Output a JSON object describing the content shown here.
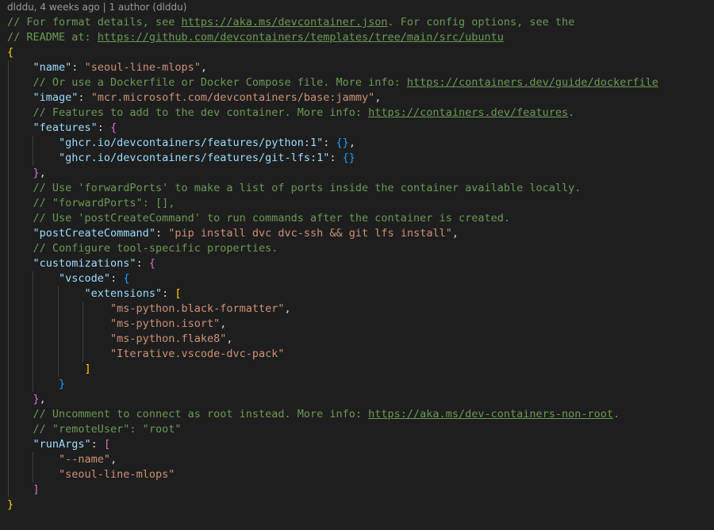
{
  "codelens": "dlddu, 4 weeks ago | 1 author (dlddu)",
  "colors": {
    "background": "#1e1e1e",
    "comment": "#6a9955",
    "key": "#9cdcfe",
    "string": "#ce9178",
    "bracket_level1": "#ffd700",
    "bracket_level2": "#da70d6",
    "bracket_level3": "#179fff"
  },
  "lines": [
    {
      "indent": 0,
      "tokens": [
        {
          "t": "// For format details, see ",
          "c": "cm"
        },
        {
          "t": "https://aka.ms/devcontainer.json",
          "c": "lnk"
        },
        {
          "t": ". For config options, see the",
          "c": "cm"
        }
      ]
    },
    {
      "indent": 0,
      "tokens": [
        {
          "t": "// README at: ",
          "c": "cm"
        },
        {
          "t": "https://github.com/devcontainers/templates/tree/main/src/ubuntu",
          "c": "lnk"
        }
      ]
    },
    {
      "indent": 0,
      "tokens": [
        {
          "t": "{",
          "c": "b1"
        }
      ]
    },
    {
      "indent": 1,
      "tokens": [
        {
          "t": "\"name\"",
          "c": "key"
        },
        {
          "t": ": ",
          "c": "pun"
        },
        {
          "t": "\"seoul-line-mlops\"",
          "c": "str"
        },
        {
          "t": ",",
          "c": "pun"
        }
      ]
    },
    {
      "indent": 1,
      "tokens": [
        {
          "t": "// Or use a Dockerfile or Docker Compose file. More info: ",
          "c": "cm"
        },
        {
          "t": "https://containers.dev/guide/dockerfile",
          "c": "lnk"
        }
      ]
    },
    {
      "indent": 1,
      "tokens": [
        {
          "t": "\"image\"",
          "c": "key"
        },
        {
          "t": ": ",
          "c": "pun"
        },
        {
          "t": "\"mcr.microsoft.com/devcontainers/base:jammy\"",
          "c": "str"
        },
        {
          "t": ",",
          "c": "pun"
        }
      ]
    },
    {
      "indent": 1,
      "tokens": [
        {
          "t": "// Features to add to the dev container. More info: ",
          "c": "cm"
        },
        {
          "t": "https://containers.dev/features",
          "c": "lnk"
        },
        {
          "t": ".",
          "c": "cm"
        }
      ]
    },
    {
      "indent": 1,
      "tokens": [
        {
          "t": "\"features\"",
          "c": "key"
        },
        {
          "t": ": ",
          "c": "pun"
        },
        {
          "t": "{",
          "c": "b2"
        }
      ]
    },
    {
      "indent": 2,
      "tokens": [
        {
          "t": "\"ghcr.io/devcontainers/features/python:1\"",
          "c": "key"
        },
        {
          "t": ": ",
          "c": "pun"
        },
        {
          "t": "{}",
          "c": "b3"
        },
        {
          "t": ",",
          "c": "pun"
        }
      ]
    },
    {
      "indent": 2,
      "tokens": [
        {
          "t": "\"ghcr.io/devcontainers/features/git-lfs:1\"",
          "c": "key"
        },
        {
          "t": ": ",
          "c": "pun"
        },
        {
          "t": "{}",
          "c": "b3"
        }
      ]
    },
    {
      "indent": 1,
      "tokens": [
        {
          "t": "}",
          "c": "b2"
        },
        {
          "t": ",",
          "c": "pun"
        }
      ]
    },
    {
      "indent": 1,
      "tokens": [
        {
          "t": "// Use 'forwardPorts' to make a list of ports inside the container available locally.",
          "c": "cm"
        }
      ]
    },
    {
      "indent": 1,
      "tokens": [
        {
          "t": "// \"forwardPorts\": [],",
          "c": "cm"
        }
      ]
    },
    {
      "indent": 1,
      "tokens": [
        {
          "t": "// Use 'postCreateCommand' to run commands after the container is created.",
          "c": "cm"
        }
      ]
    },
    {
      "indent": 1,
      "tokens": [
        {
          "t": "\"postCreateCommand\"",
          "c": "key"
        },
        {
          "t": ": ",
          "c": "pun"
        },
        {
          "t": "\"pip install dvc dvc-ssh && git lfs install\"",
          "c": "str"
        },
        {
          "t": ",",
          "c": "pun"
        }
      ]
    },
    {
      "indent": 1,
      "tokens": [
        {
          "t": "// Configure tool-specific properties.",
          "c": "cm"
        }
      ]
    },
    {
      "indent": 1,
      "tokens": [
        {
          "t": "\"customizations\"",
          "c": "key"
        },
        {
          "t": ": ",
          "c": "pun"
        },
        {
          "t": "{",
          "c": "b2"
        }
      ]
    },
    {
      "indent": 2,
      "tokens": [
        {
          "t": "\"vscode\"",
          "c": "key"
        },
        {
          "t": ": ",
          "c": "pun"
        },
        {
          "t": "{",
          "c": "b3"
        }
      ]
    },
    {
      "indent": 3,
      "tokens": [
        {
          "t": "\"extensions\"",
          "c": "key"
        },
        {
          "t": ": ",
          "c": "pun"
        },
        {
          "t": "[",
          "c": "b1"
        }
      ]
    },
    {
      "indent": 4,
      "tokens": [
        {
          "t": "\"ms-python.black-formatter\"",
          "c": "str"
        },
        {
          "t": ",",
          "c": "pun"
        }
      ]
    },
    {
      "indent": 4,
      "tokens": [
        {
          "t": "\"ms-python.isort\"",
          "c": "str"
        },
        {
          "t": ",",
          "c": "pun"
        }
      ]
    },
    {
      "indent": 4,
      "tokens": [
        {
          "t": "\"ms-python.flake8\"",
          "c": "str"
        },
        {
          "t": ",",
          "c": "pun"
        }
      ]
    },
    {
      "indent": 4,
      "tokens": [
        {
          "t": "\"Iterative.vscode-dvc-pack\"",
          "c": "str"
        }
      ]
    },
    {
      "indent": 3,
      "tokens": [
        {
          "t": "]",
          "c": "b1"
        }
      ]
    },
    {
      "indent": 2,
      "tokens": [
        {
          "t": "}",
          "c": "b3"
        }
      ]
    },
    {
      "indent": 1,
      "tokens": [
        {
          "t": "}",
          "c": "b2"
        },
        {
          "t": ",",
          "c": "pun"
        }
      ]
    },
    {
      "indent": 1,
      "tokens": [
        {
          "t": "// Uncomment to connect as root instead. More info: ",
          "c": "cm"
        },
        {
          "t": "https://aka.ms/dev-containers-non-root",
          "c": "lnk"
        },
        {
          "t": ".",
          "c": "cm"
        }
      ]
    },
    {
      "indent": 1,
      "tokens": [
        {
          "t": "// \"remoteUser\": \"root\"",
          "c": "cm"
        }
      ]
    },
    {
      "indent": 1,
      "tokens": [
        {
          "t": "\"runArgs\"",
          "c": "key"
        },
        {
          "t": ": ",
          "c": "pun"
        },
        {
          "t": "[",
          "c": "b2"
        }
      ]
    },
    {
      "indent": 2,
      "tokens": [
        {
          "t": "\"--name\"",
          "c": "str"
        },
        {
          "t": ",",
          "c": "pun"
        }
      ]
    },
    {
      "indent": 2,
      "tokens": [
        {
          "t": "\"seoul-line-mlops\"",
          "c": "str"
        }
      ]
    },
    {
      "indent": 1,
      "tokens": [
        {
          "t": "]",
          "c": "b2"
        }
      ]
    },
    {
      "indent": 0,
      "tokens": [
        {
          "t": "}",
          "c": "b1"
        }
      ]
    }
  ]
}
